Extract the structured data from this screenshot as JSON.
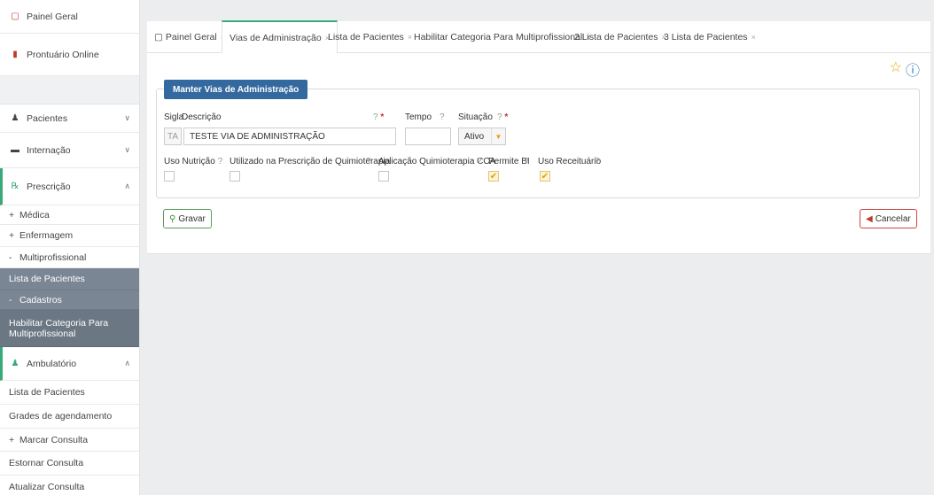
{
  "sidebar": {
    "top_items": [
      {
        "label": "Painel Geral",
        "icon": "monitor-icon"
      },
      {
        "label": "Prontuário Online",
        "icon": "folder-icon"
      }
    ],
    "pacientes": "Pacientes",
    "internacao": "Internação",
    "prescricao": "Prescrição",
    "medica": "Médica",
    "enfermagem": "Enfermagem",
    "multiprofissional": "Multiprofissional",
    "lista_pacientes": "Lista de Pacientes",
    "cadastros": "Cadastros",
    "habilitar": "Habilitar Categoria Para Multiprofissional",
    "ambulatorio": "Ambulatório",
    "amb_lista": "Lista de Pacientes",
    "grades": "Grades de agendamento",
    "marcar": "Marcar Consulta",
    "estornar": "Estornar Consulta",
    "atualizar": "Atualizar Consulta",
    "plus": "+",
    "minus": "-"
  },
  "tabs": [
    {
      "label": "Painel Geral"
    },
    {
      "label": "Vias de Administração"
    },
    {
      "label": "Lista de Pacientes"
    },
    {
      "label": "Habilitar Categoria Para Multiprofissional"
    },
    {
      "label": "2 Lista de Pacientes"
    },
    {
      "label": "3 Lista de Pacientes"
    }
  ],
  "form": {
    "legend": "Manter Vias de Administração",
    "sigla_label": "Sigla",
    "sigla_value": "TA",
    "descricao_label": "Descrição",
    "descricao_value": "TESTE VIA DE ADMINISTRAÇÃO",
    "tempo_label": "Tempo",
    "tempo_value": "",
    "situacao_label": "Situação",
    "situacao_value": "Ativo",
    "uso_nutricao": "Uso Nutrição",
    "quimio": "Utilizado na Prescrição de Quimioterapia",
    "aplicacao": "Aplicação Quimioterapia CCA",
    "permite_bi": "Permite BI",
    "uso_receituario": "Uso Receituário",
    "help": "?",
    "required": "*"
  },
  "buttons": {
    "gravar": "Gravar",
    "cancelar": "Cancelar"
  },
  "colors": {
    "accent": "#3aa97a",
    "legend": "#34699f",
    "sidebar_dark": "#7b8694"
  }
}
